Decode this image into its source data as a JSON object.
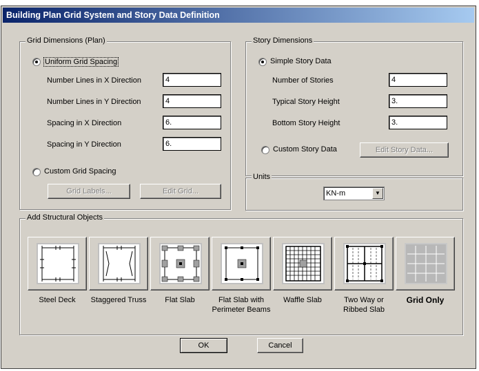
{
  "window": {
    "title": "Building Plan Grid System and Story Data Definition"
  },
  "grid": {
    "legend": "Grid Dimensions (Plan)",
    "uniform_label": "Uniform Grid Spacing",
    "rows": [
      {
        "label": "Number Lines in X Direction",
        "value": "4"
      },
      {
        "label": "Number Lines in Y Direction",
        "value": "4"
      },
      {
        "label": "Spacing in X Direction",
        "value": "6."
      },
      {
        "label": "Spacing in Y Direction",
        "value": "6."
      }
    ],
    "custom_label": "Custom Grid Spacing",
    "grid_labels_btn": "Grid Labels...",
    "edit_grid_btn": "Edit Grid..."
  },
  "story": {
    "legend": "Story Dimensions",
    "simple_label": "Simple Story Data",
    "rows": [
      {
        "label": "Number of Stories",
        "value": "4"
      },
      {
        "label": "Typical Story Height",
        "value": "3."
      },
      {
        "label": "Bottom Story Height",
        "value": "3."
      }
    ],
    "custom_label": "Custom Story Data",
    "edit_story_btn": "Edit Story Data..."
  },
  "units": {
    "legend": "Units",
    "selected": "KN-m"
  },
  "structural": {
    "legend": "Add Structural Objects",
    "tiles": [
      {
        "label": "Steel Deck",
        "icon": "steel-deck-icon"
      },
      {
        "label": "Staggered Truss",
        "icon": "staggered-truss-icon"
      },
      {
        "label": "Flat Slab",
        "icon": "flat-slab-icon"
      },
      {
        "label": "Flat Slab with Perimeter Beams",
        "icon": "flat-slab-perimeter-icon"
      },
      {
        "label": "Waffle Slab",
        "icon": "waffle-slab-icon"
      },
      {
        "label": "Two Way or Ribbed Slab",
        "icon": "ribbed-slab-icon"
      },
      {
        "label": "Grid Only",
        "icon": "grid-only-icon"
      }
    ]
  },
  "buttons": {
    "ok": "OK",
    "cancel": "Cancel"
  }
}
